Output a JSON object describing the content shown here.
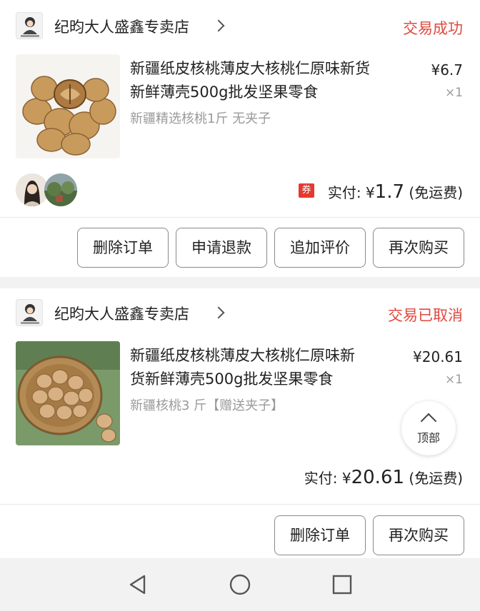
{
  "orders": [
    {
      "shop_name": "纪昀大人盛鑫专卖店",
      "status": "交易成功",
      "title_line1": "新疆纸皮核桃薄皮大核桃仁原味新货",
      "title_line2": "新鲜薄壳500g批发坚果零食",
      "sku": "新疆精选核桃1斤 无夹子",
      "price": "¥6.7",
      "qty": "×1",
      "coupon_icon": "券",
      "paid_label": "实付: ",
      "paid_currency": "¥",
      "paid_amount": "1.7",
      "shipping": " (免运费)",
      "buttons": [
        "删除订单",
        "申请退款",
        "追加评价",
        "再次购买"
      ]
    },
    {
      "shop_name": "纪昀大人盛鑫专卖店",
      "status": "交易已取消",
      "title_line1": "新疆纸皮核桃薄皮大核桃仁原味新",
      "title_line2": "货新鲜薄壳500g批发坚果零食",
      "sku": "新疆核桃3 斤【赠送夹子】",
      "price": "¥20.61",
      "qty": "×1",
      "paid_label": "实付: ",
      "paid_currency": "¥",
      "paid_amount": "20.61",
      "shipping": " (免运费)",
      "buttons": [
        "删除订单",
        "再次购买"
      ]
    }
  ],
  "back_to_top": "顶部",
  "colors": {
    "status_red": "#e0483e",
    "coupon_red": "#e5392f"
  },
  "nav": [
    "back-icon",
    "home-icon",
    "recents-icon"
  ]
}
